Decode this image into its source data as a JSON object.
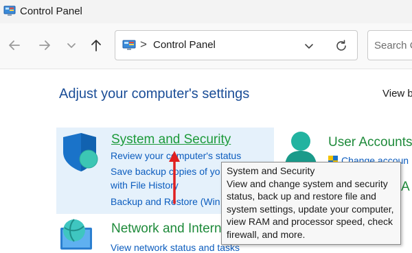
{
  "window": {
    "title": "Control Panel"
  },
  "navigation": {
    "back_icon": "back-arrow-icon",
    "forward_icon": "forward-arrow-icon",
    "recent_icon": "chevron-down-icon",
    "up_icon": "up-arrow-icon"
  },
  "address_bar": {
    "separator": ">",
    "path": "Control Panel"
  },
  "search": {
    "placeholder": "Search C"
  },
  "main": {
    "heading": "Adjust your computer's settings",
    "view_by": "View b",
    "categories": [
      {
        "title": "System and Security",
        "links": [
          "Review your computer's status",
          "Save backup copies of yo",
          "with File History",
          "Backup and Restore (Win"
        ]
      },
      {
        "title": "Network and Intern",
        "links": [
          "View network status and tasks"
        ]
      },
      {
        "title": "User Accounts",
        "links": [
          "Change accoun"
        ]
      },
      {
        "title": "A",
        "links": []
      }
    ]
  },
  "tooltip": {
    "title": "System and Security",
    "body": "View and change system and security status, back up and restore file and system settings, update your computer, view RAM and processor speed, check firewall, and more."
  },
  "colors": {
    "heading": "#1a4d97",
    "category_title": "#1e8a3a",
    "link": "#0b5cbe",
    "highlight": "#e5f1fb",
    "arrow": "#e02020"
  }
}
